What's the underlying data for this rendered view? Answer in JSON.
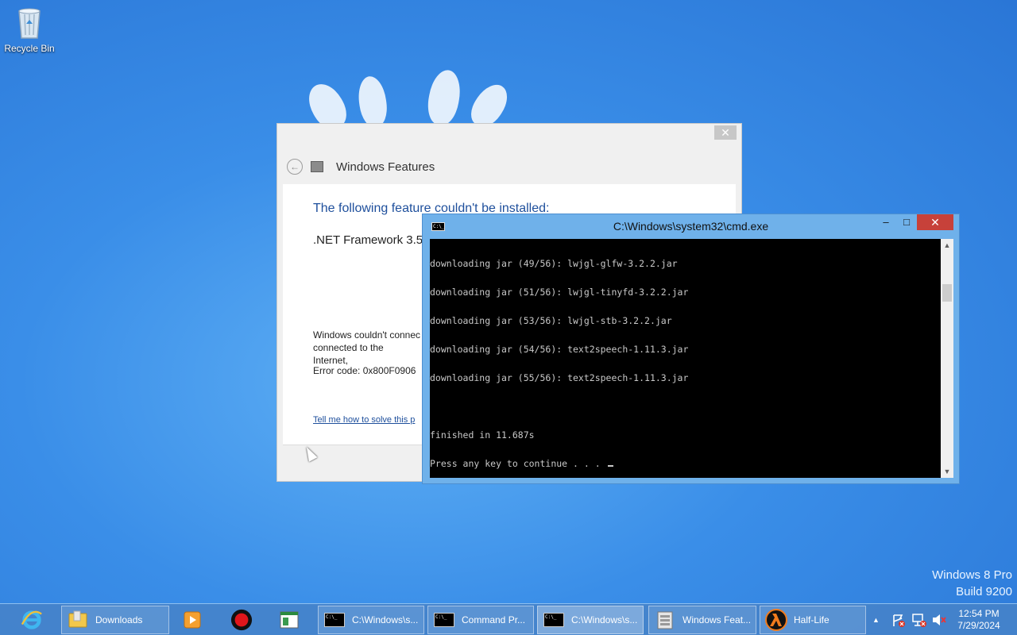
{
  "desktop": {
    "recycle_bin_label": "Recycle Bin",
    "watermark_line1": "Windows 8 Pro",
    "watermark_line2": "Build 9200"
  },
  "windows_features": {
    "title": "Windows Features",
    "close_glyph": "✕",
    "back_glyph": "←",
    "heading": "The following feature couldn't be installed:",
    "feature": ".NET Framework 3.5 (",
    "message_line1": "Windows couldn't connec",
    "message_line2": "connected to the Internet,",
    "error_code": "Error code: 0x800F0906",
    "help_link": "Tell me how to solve this p"
  },
  "cmd": {
    "title": "C:\\Windows\\system32\\cmd.exe",
    "minimize_glyph": "–",
    "maximize_glyph": "□",
    "close_glyph": "✕",
    "lines": [
      "downloading jar (49/56): lwjgl-glfw-3.2.2.jar",
      "downloading jar (51/56): lwjgl-tinyfd-3.2.2.jar",
      "downloading jar (53/56): lwjgl-stb-3.2.2.jar",
      "downloading jar (54/56): text2speech-1.11.3.jar",
      "downloading jar (55/56): text2speech-1.11.3.jar",
      "",
      "finished in 11.687s",
      "Press any key to continue . . . "
    ]
  },
  "taskbar": {
    "items": [
      {
        "label": "",
        "icon": "internet-explorer-icon"
      },
      {
        "label": "Downloads",
        "icon": "folder-icon"
      },
      {
        "label": "",
        "icon": "media-player-icon"
      },
      {
        "label": "",
        "icon": "record-icon"
      },
      {
        "label": "",
        "icon": "window-app-icon"
      },
      {
        "label": "C:\\Windows\\s...",
        "icon": "cmd-icon"
      },
      {
        "label": "Command Pr...",
        "icon": "cmd-icon"
      },
      {
        "label": "C:\\Windows\\s...",
        "icon": "cmd-icon"
      },
      {
        "label": "Windows Feat...",
        "icon": "windows-features-icon"
      },
      {
        "label": "Half-Life",
        "icon": "half-life-icon"
      }
    ],
    "tray": {
      "show_hidden_glyph": "▲",
      "time": "12:54 PM",
      "date": "7/29/2024"
    }
  },
  "colors": {
    "accent_blue": "#1e4f9c",
    "cmd_close_red": "#c7413a",
    "record_red": "#e0161b"
  }
}
